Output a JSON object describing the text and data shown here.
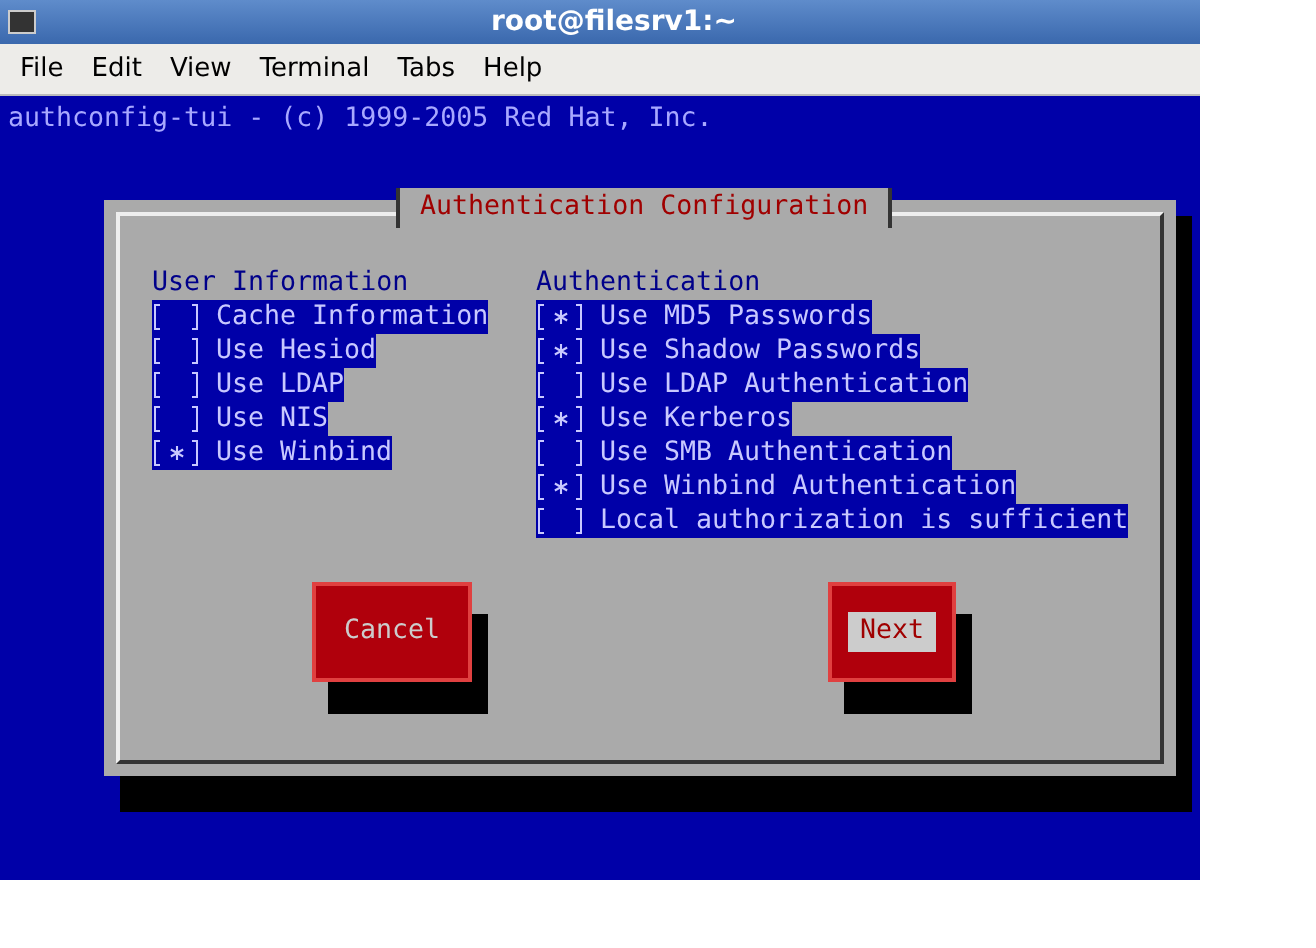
{
  "window": {
    "title": "root@filesrv1:~"
  },
  "menu": [
    {
      "label": "File"
    },
    {
      "label": "Edit"
    },
    {
      "label": "View"
    },
    {
      "label": "Terminal"
    },
    {
      "label": "Tabs"
    },
    {
      "label": "Help"
    }
  ],
  "terminal": {
    "header": "authconfig-tui - (c) 1999-2005 Red Hat, Inc."
  },
  "dialog": {
    "title": "Authentication Configuration",
    "user_information": {
      "heading": "User Information",
      "options": [
        {
          "label": "Cache Information",
          "checked": false
        },
        {
          "label": "Use Hesiod",
          "checked": false
        },
        {
          "label": "Use LDAP",
          "checked": false
        },
        {
          "label": "Use NIS",
          "checked": false
        },
        {
          "label": "Use Winbind",
          "checked": true
        }
      ]
    },
    "authentication": {
      "heading": "Authentication",
      "options": [
        {
          "label": "Use MD5 Passwords",
          "checked": true
        },
        {
          "label": "Use Shadow Passwords",
          "checked": true
        },
        {
          "label": "Use LDAP Authentication",
          "checked": false
        },
        {
          "label": "Use Kerberos",
          "checked": true
        },
        {
          "label": "Use SMB Authentication",
          "checked": false
        },
        {
          "label": "Use Winbind Authentication",
          "checked": true
        },
        {
          "label": "Local authorization is sufficient",
          "checked": false
        }
      ]
    },
    "buttons": [
      {
        "label": "Cancel",
        "selected": false
      },
      {
        "label": "Next",
        "selected": true
      }
    ]
  }
}
